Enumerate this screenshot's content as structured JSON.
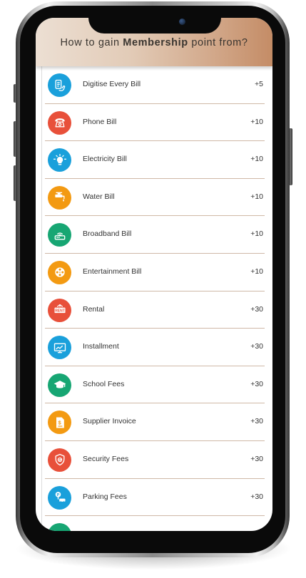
{
  "header": {
    "title_pre": "How to gain",
    "title_bold": "Membership",
    "title_post": "point from?"
  },
  "colors": {
    "blue": "#1aa0db",
    "red": "#e8503a",
    "orange": "#f39a12",
    "green": "#17a673",
    "header_start": "#ecdfd3",
    "header_end": "#c48c66",
    "divider": "#cfb8a6"
  },
  "items": [
    {
      "label": "Digitise Every Bill",
      "points": "+5",
      "icon": "receipt-hand-icon",
      "color": "blue"
    },
    {
      "label": "Phone Bill",
      "points": "+10",
      "icon": "telephone-icon",
      "color": "red"
    },
    {
      "label": "Electricity Bill",
      "points": "+10",
      "icon": "lightbulb-icon",
      "color": "blue"
    },
    {
      "label": "Water Bill",
      "points": "+10",
      "icon": "water-tap-icon",
      "color": "orange"
    },
    {
      "label": "Broadband Bill",
      "points": "+10",
      "icon": "router-icon",
      "color": "green"
    },
    {
      "label": "Entertainment Bill",
      "points": "+10",
      "icon": "film-reel-icon",
      "color": "orange"
    },
    {
      "label": "Rental",
      "points": "+30",
      "icon": "rent-sign-icon",
      "color": "red"
    },
    {
      "label": "Installment",
      "points": "+30",
      "icon": "monitor-chart-icon",
      "color": "blue"
    },
    {
      "label": "School Fees",
      "points": "+30",
      "icon": "graduation-cap-icon",
      "color": "green"
    },
    {
      "label": "Supplier Invoice",
      "points": "+30",
      "icon": "invoice-icon",
      "color": "orange"
    },
    {
      "label": "Security Fees",
      "points": "+30",
      "icon": "shield-icon",
      "color": "red"
    },
    {
      "label": "Parking Fees",
      "points": "+30",
      "icon": "parking-car-icon",
      "color": "blue"
    },
    {
      "label": "",
      "points": "",
      "icon": "partial-item-icon",
      "color": "green"
    }
  ]
}
